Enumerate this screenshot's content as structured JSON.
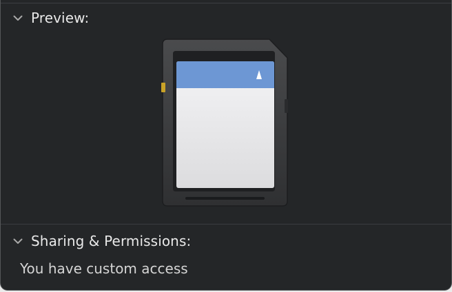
{
  "preview_section": {
    "title": "Preview:",
    "expanded": true,
    "icon": "sd-card-icon",
    "colors": {
      "label_band": "#6d97d4",
      "card_body": "#3a3b3d",
      "contact": "#c9a227"
    }
  },
  "sharing_section": {
    "title": "Sharing & Permissions:",
    "expanded": true,
    "access_text": "You have custom access"
  }
}
